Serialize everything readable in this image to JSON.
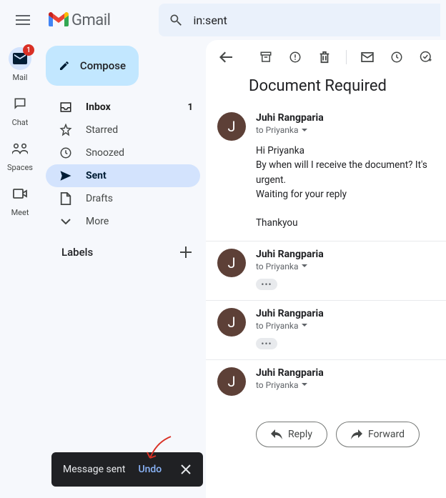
{
  "header": {
    "app_name": "Gmail",
    "search_value": "in:sent"
  },
  "rail": {
    "items": [
      {
        "label": "Mail",
        "badge": "1"
      },
      {
        "label": "Chat"
      },
      {
        "label": "Spaces"
      },
      {
        "label": "Meet"
      }
    ]
  },
  "sidebar": {
    "compose_label": "Compose",
    "folders": [
      {
        "label": "Inbox",
        "count": "1"
      },
      {
        "label": "Starred"
      },
      {
        "label": "Snoozed"
      },
      {
        "label": "Sent"
      },
      {
        "label": "Drafts"
      },
      {
        "label": "More"
      }
    ],
    "labels_title": "Labels"
  },
  "thread": {
    "subject": "Document Required",
    "messages": [
      {
        "avatar_letter": "J",
        "sender": "Juhi Rangparia",
        "to": "to Priyanka",
        "body_lines": [
          "Hi Priyanka",
          "By when will I receive the document? It's urgent.",
          "Waiting for your reply"
        ],
        "signoff": "Thankyou"
      },
      {
        "avatar_letter": "J",
        "sender": "Juhi Rangparia",
        "to": "to Priyanka"
      },
      {
        "avatar_letter": "J",
        "sender": "Juhi Rangparia",
        "to": "to Priyanka"
      },
      {
        "avatar_letter": "J",
        "sender": "Juhi Rangparia",
        "to": "to Priyanka"
      }
    ],
    "reply_label": "Reply",
    "forward_label": "Forward"
  },
  "toast": {
    "message": "Message sent",
    "undo_label": "Undo"
  }
}
